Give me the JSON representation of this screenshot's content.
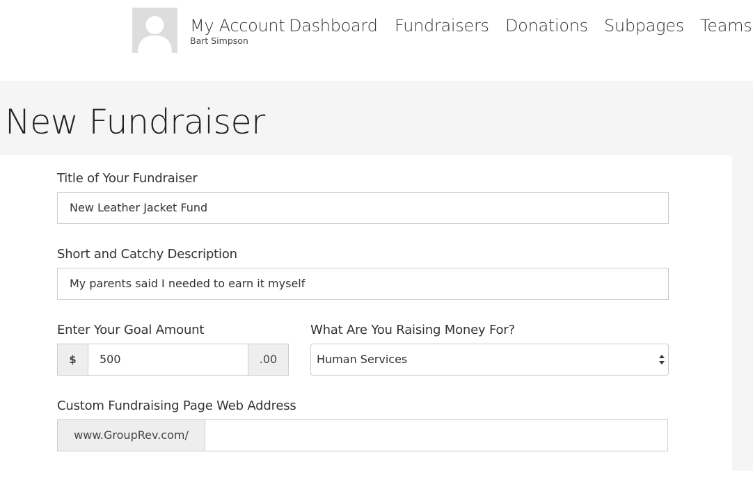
{
  "header": {
    "account_title": "My Account",
    "account_user": "Bart Simpson",
    "nav": [
      {
        "label": "Dashboard"
      },
      {
        "label": "Fundraisers"
      },
      {
        "label": "Donations"
      },
      {
        "label": "Subpages"
      },
      {
        "label": "Teams"
      }
    ]
  },
  "page": {
    "title": "New Fundraiser"
  },
  "form": {
    "title_label": "Title of Your Fundraiser",
    "title_value": "New Leather Jacket Fund",
    "description_label": "Short and Catchy Description",
    "description_value": "My parents said I needed to earn it myself",
    "goal_label": "Enter Your Goal Amount",
    "goal_prefix": "$",
    "goal_value": "500",
    "goal_suffix": ".00",
    "purpose_label": "What Are You Raising Money For?",
    "purpose_value": "Human Services",
    "url_label": "Custom Fundraising Page Web Address",
    "url_prefix": "www.GroupRev.com/",
    "url_value": ""
  },
  "colors": {
    "background_gray": "#f5f5f5",
    "input_border": "#cccccc",
    "addon_background": "#eeeeee"
  },
  "icons": {
    "avatar": "default-user-silhouette",
    "select": "up-down-chevron"
  }
}
